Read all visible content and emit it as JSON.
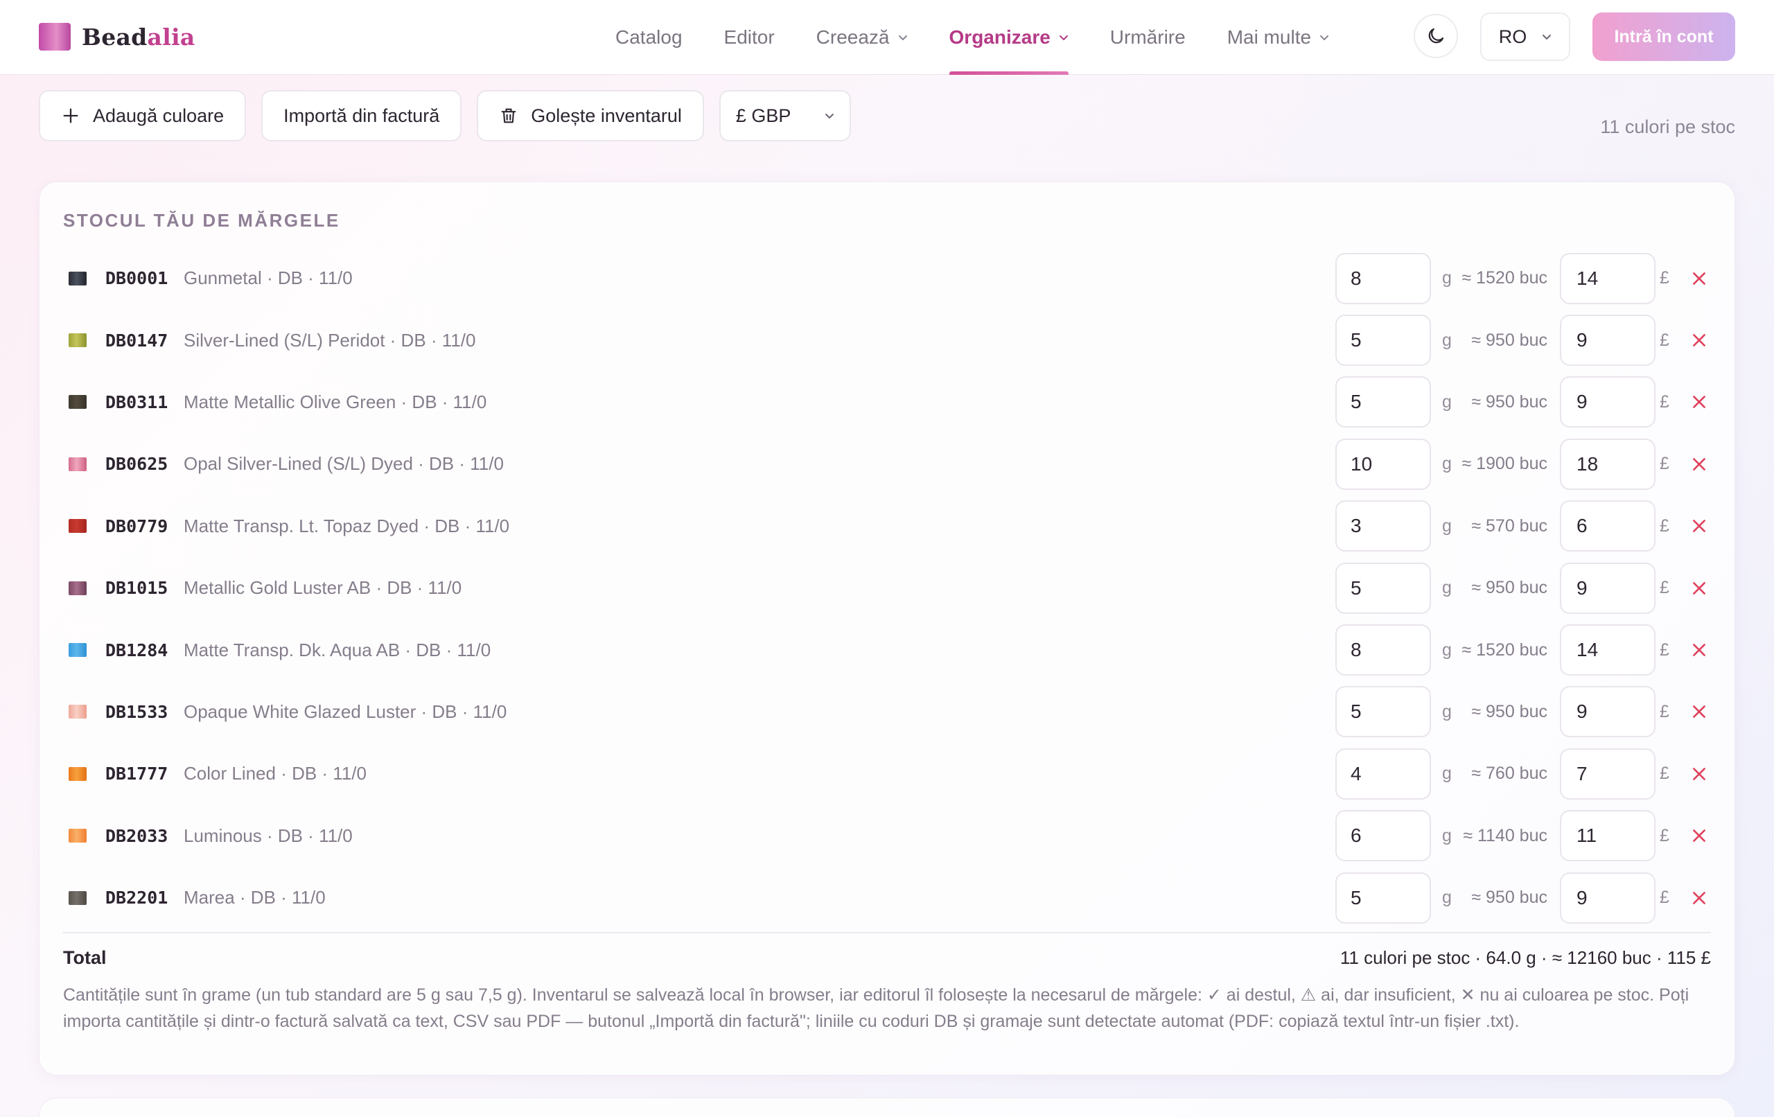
{
  "app": {
    "brand_part1": "Bead",
    "brand_part2": "alia"
  },
  "nav": {
    "catalog": "Catalog",
    "editor": "Editor",
    "create": "Creează",
    "organize": "Organizare",
    "tracking": "Urmărire",
    "more": "Mai multe",
    "active": "Organizare"
  },
  "header": {
    "language": "RO",
    "login": "Intră în cont",
    "theme_icon": "moon-icon"
  },
  "toolbar": {
    "add_color": "Adaugă culoare",
    "import_invoice": "Importă din factură",
    "clear_inventory": "Golește inventarul",
    "currency": "£ GBP",
    "stock_count": "11 culori pe stoc"
  },
  "inventory": {
    "title": "STOCUL TĂU DE MĂRGELE",
    "gram_unit": "g",
    "currency_symbol": "£",
    "items": [
      {
        "code": "DB0001",
        "name": "Gunmetal · DB · 11/0",
        "grams": "8",
        "pieces": "≈ 1520 buc",
        "price": "14",
        "swatch": [
          "#2c2d35",
          "#4c5260",
          "#23242b"
        ]
      },
      {
        "code": "DB0147",
        "name": "Silver-Lined (S/L) Peridot · DB · 11/0",
        "grams": "5",
        "pieces": "≈ 950 buc",
        "price": "9",
        "swatch": [
          "#9ea63a",
          "#c4c45a",
          "#8a922e"
        ]
      },
      {
        "code": "DB0311",
        "name": "Matte Metallic Olive Green · DB · 11/0",
        "grams": "5",
        "pieces": "≈ 950 buc",
        "price": "9",
        "swatch": [
          "#3f3a2f",
          "#524b3d",
          "#37322a"
        ]
      },
      {
        "code": "DB0625",
        "name": "Opal Silver-Lined (S/L) Dyed · DB · 11/0",
        "grams": "10",
        "pieces": "≈ 1900 buc",
        "price": "18",
        "swatch": [
          "#d76d8e",
          "#f0a7bd",
          "#cc5f82"
        ]
      },
      {
        "code": "DB0779",
        "name": "Matte Transp. Lt. Topaz Dyed · DB · 11/0",
        "grams": "3",
        "pieces": "≈ 570 buc",
        "price": "6",
        "swatch": [
          "#b32c25",
          "#c83a30",
          "#a6261f"
        ]
      },
      {
        "code": "DB1015",
        "name": "Metallic Gold Luster AB · DB · 11/0",
        "grams": "5",
        "pieces": "≈ 950 buc",
        "price": "9",
        "swatch": [
          "#7c4a63",
          "#a86f8c",
          "#6e3f57"
        ]
      },
      {
        "code": "DB1284",
        "name": "Matte Transp. Dk. Aqua AB · DB · 11/0",
        "grams": "8",
        "pieces": "≈ 1520 buc",
        "price": "14",
        "swatch": [
          "#3a9ede",
          "#5bb6ec",
          "#2f90d2"
        ]
      },
      {
        "code": "DB1533",
        "name": "Opaque White Glazed Luster · DB · 11/0",
        "grams": "5",
        "pieces": "≈ 950 buc",
        "price": "9",
        "swatch": [
          "#f0a999",
          "#f8d0c6",
          "#ec9c8b"
        ]
      },
      {
        "code": "DB1777",
        "name": "Color Lined · DB · 11/0",
        "grams": "4",
        "pieces": "≈ 760 buc",
        "price": "7",
        "swatch": [
          "#ec7a1e",
          "#f7a13c",
          "#e26f16"
        ]
      },
      {
        "code": "DB2033",
        "name": "Luminous · DB · 11/0",
        "grams": "6",
        "pieces": "≈ 1140 buc",
        "price": "11",
        "swatch": [
          "#f28a3c",
          "#fbb068",
          "#ee7f30"
        ]
      },
      {
        "code": "DB2201",
        "name": "Marea · DB · 11/0",
        "grams": "5",
        "pieces": "≈ 950 buc",
        "price": "9",
        "swatch": [
          "#5a5550",
          "#76706a",
          "#4d4843"
        ]
      }
    ],
    "total_label": "Total",
    "total_summary": "11 culori pe stoc · 64.0 g · ≈ 12160 buc · 115 £",
    "note": "Cantitățile sunt în grame (un tub standard are 5 g sau 7,5 g). Inventarul se salvează local în browser, iar editorul îl folosește la necesarul de mărgele: ✓ ai destul, ⚠ ai, dar insuficient, ✕ nu ai culoarea pe stoc. Poți importa cantitățile și dintr-o factură salvată ca text, CSV sau PDF — butonul „Importă din factură\"; liniile cu coduri DB și gramaje sunt detectate automat (PDF: copiază textul într-un fișier .txt)."
  },
  "colors": {
    "accent": "#b53a86",
    "delete": "#e0405c"
  }
}
